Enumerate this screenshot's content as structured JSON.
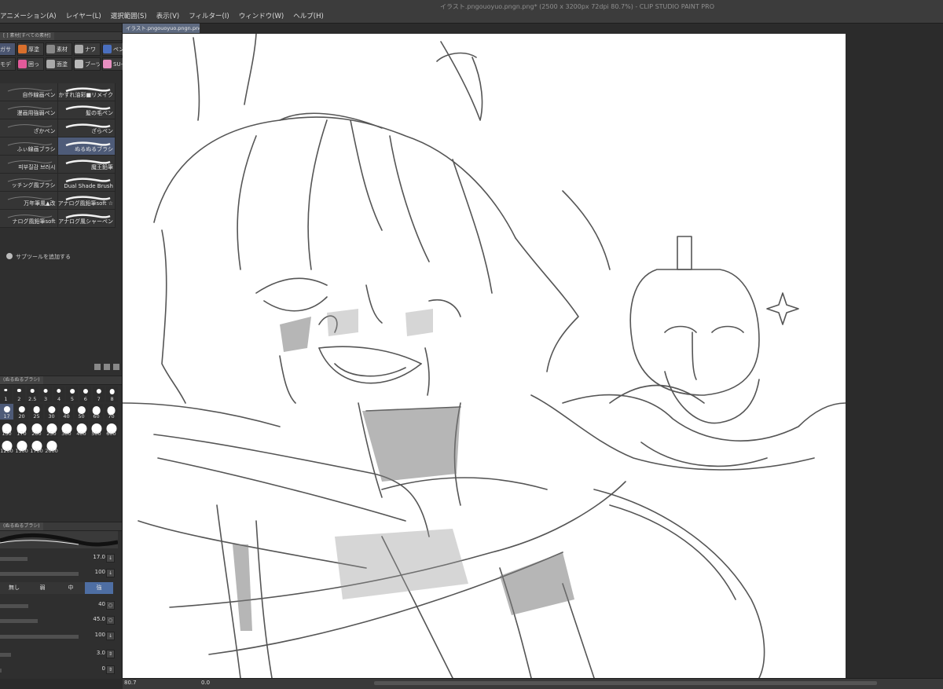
{
  "titlebar": {
    "text": "イラスト.pngouoyuo.pngn.png* (2500 x 3200px 72dpi 80.7%) - CLIP STUDIO PAINT PRO"
  },
  "menu": [
    "アニメーション(A)",
    "レイヤー(L)",
    "選択範囲(S)",
    "表示(V)",
    "フィルター(I)",
    "ウィンドウ(W)",
    "ヘルプ(H)"
  ],
  "document_tab": "イラスト.pngouoyuo.pngn.png*",
  "tool_panel": {
    "tab_label": "[ ] 素材[すべての素材]",
    "groups": [
      {
        "label": "ガサ",
        "color": "#7d4cc4",
        "selected": true
      },
      {
        "label": "厚塗",
        "color": "#d96f2c"
      },
      {
        "label": "素材",
        "color": "#888888"
      },
      {
        "label": "ナワ",
        "color": "#aaaaaa"
      },
      {
        "label": "ペン",
        "color": "#4a6fbf"
      },
      {
        "label": "モデ",
        "color": "#e0782f"
      },
      {
        "label": "囲っ",
        "color": "#e25a9a"
      },
      {
        "label": "面塗",
        "color": "#aaaaaa"
      },
      {
        "label": "ブーツ",
        "color": "#bbbbbb"
      },
      {
        "label": "SU-",
        "color": "#e68fc0"
      }
    ],
    "subtools": [
      {
        "left": "自作線画ペン",
        "right": "かすれ油彩■リメイク"
      },
      {
        "left": "漫画用強弱ペン",
        "right": "髪の毛ペン"
      },
      {
        "left": "ざかペン",
        "right": "ざらペン"
      },
      {
        "left": "ふぃ線画ブラシ",
        "right": "ぬるぬるブラシ",
        "right_selected": true
      },
      {
        "left": "피부질감 브러시",
        "right": "魔王鉛筆"
      },
      {
        "left": "ッチング風ブラシ",
        "right": "Dual Shade Brush"
      },
      {
        "left": "万年筆風▲改",
        "right": "アナログ風鉛筆soft ☆"
      },
      {
        "left": "ナログ風鉛筆soft",
        "right": "アナログ風シャーペン"
      }
    ],
    "add_subtool_label": "サブツールを追加する"
  },
  "brush_size_panel": {
    "tab_label": "(ぬるぬるブラシ)",
    "rows": [
      [
        "1",
        "2",
        "2.5",
        "3",
        "4",
        "5",
        "6",
        "7",
        "8"
      ],
      [
        "17",
        "20",
        "25",
        "30",
        "40",
        "50",
        "60",
        "70"
      ],
      [
        "150",
        "170",
        "200",
        "250",
        "300",
        "400",
        "500",
        "600"
      ],
      [
        "1200",
        "1500",
        "1700",
        "2000"
      ]
    ],
    "selected": "17"
  },
  "tool_property": {
    "tab_label": "(ぬるぬるブラシ)",
    "brush_size": "17.0",
    "opacity": "100",
    "antialias": [
      "無し",
      "弱",
      "中",
      "強"
    ],
    "antialias_selected": "強",
    "values": [
      "40",
      "45.0",
      "100",
      "3.0",
      "0"
    ]
  },
  "status": {
    "zoom": "80.7",
    "rotation": "0.0"
  }
}
